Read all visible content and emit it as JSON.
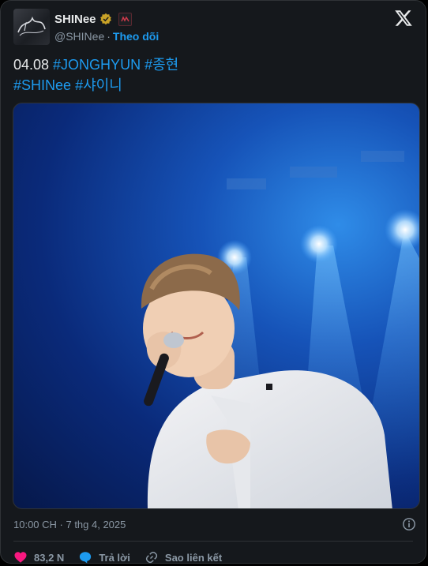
{
  "author": {
    "name": "SHINee",
    "handle": "@SHINee",
    "separator": "·",
    "follow_label": "Theo dõi",
    "verified_color": "#c9a227"
  },
  "tweet": {
    "line1": [
      {
        "text": "04.08 ",
        "type": "text"
      },
      {
        "text": "#JONGHYUN",
        "type": "hashtag"
      },
      {
        "text": " ",
        "type": "text"
      },
      {
        "text": "#종현",
        "type": "hashtag"
      }
    ],
    "line2": [
      {
        "text": "#SHINee",
        "type": "hashtag"
      },
      {
        "text": " ",
        "type": "text"
      },
      {
        "text": "#샤이니",
        "type": "hashtag"
      }
    ]
  },
  "timestamp": "10:00 CH · 7 thg 4, 2025",
  "actions": {
    "likes": "83,2 N",
    "reply": "Trả lời",
    "copy_link": "Sao liên kết"
  },
  "colors": {
    "accent": "#1d9bf0",
    "like": "#f91880",
    "background": "#15181c"
  }
}
